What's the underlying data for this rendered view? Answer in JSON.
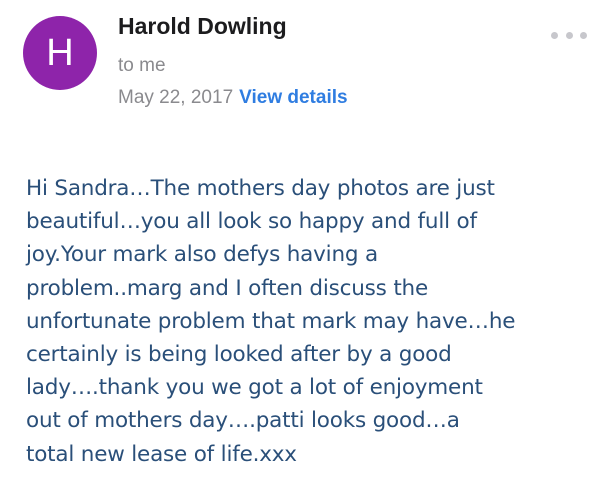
{
  "sender": {
    "avatar_initial": "H",
    "avatar_color": "#8e24aa",
    "name": "Harold Dowling"
  },
  "recipient": "to me",
  "date": "May 22, 2017",
  "view_details_label": "View details",
  "more_icon": "more-horizontal-icon",
  "colors": {
    "accent": "#2f7de1",
    "body_text": "#2a4f79",
    "muted": "#8a8a8e"
  },
  "body": {
    "lines": [
      "Hi Sandra…The mothers day photos are just",
      "beautiful…you all look so happy and full of",
      "joy.Your mark also defys having a",
      "problem..marg and I often discuss the",
      "unfortunate problem that mark may have…he",
      "certainly is being looked after by a good",
      "lady….thank you we got a lot of enjoyment",
      "out of mothers day….patti looks good…a",
      "total new lease of life.xxx"
    ]
  }
}
